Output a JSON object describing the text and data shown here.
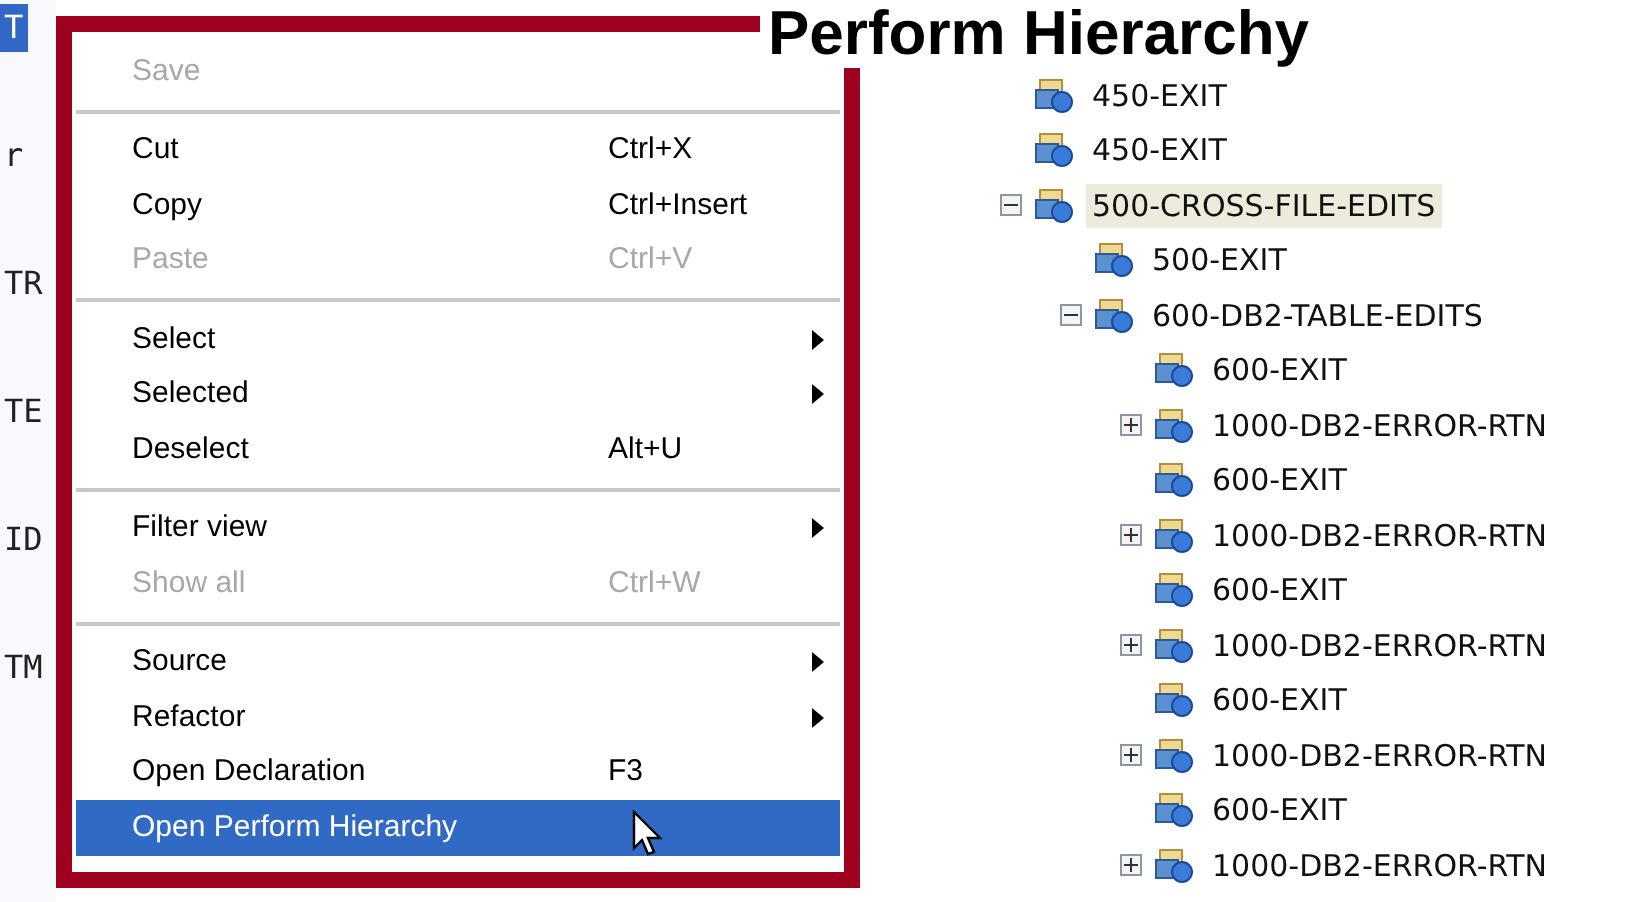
{
  "title": "Perform Hierarchy",
  "editor_fragments": [
    {
      "text": "T",
      "selected": true
    },
    {
      "text": "r",
      "selected": false
    },
    {
      "text": "TR",
      "selected": false
    },
    {
      "text": "TE",
      "selected": false
    },
    {
      "text": "ID",
      "selected": false
    },
    {
      "text": "TM",
      "selected": false
    }
  ],
  "menu": {
    "groups": [
      [
        {
          "label": "Save",
          "disabled": true,
          "submenu": false,
          "selected": false
        }
      ],
      [
        {
          "label": "Cut",
          "shortcut": "Ctrl+X",
          "disabled": false,
          "submenu": false,
          "selected": false
        },
        {
          "label": "Copy",
          "shortcut": "Ctrl+Insert",
          "disabled": false,
          "submenu": false,
          "selected": false
        },
        {
          "label": "Paste",
          "shortcut": "Ctrl+V",
          "disabled": true,
          "submenu": false,
          "selected": false
        }
      ],
      [
        {
          "label": "Select",
          "disabled": false,
          "submenu": true,
          "selected": false
        },
        {
          "label": "Selected",
          "disabled": false,
          "submenu": true,
          "selected": false
        },
        {
          "label": "Deselect",
          "shortcut": "Alt+U",
          "disabled": false,
          "submenu": false,
          "selected": false
        }
      ],
      [
        {
          "label": "Filter view",
          "disabled": false,
          "submenu": true,
          "selected": false
        },
        {
          "label": "Show all",
          "shortcut": "Ctrl+W",
          "disabled": true,
          "submenu": false,
          "selected": false
        }
      ],
      [
        {
          "label": "Source",
          "disabled": false,
          "submenu": true,
          "selected": false
        },
        {
          "label": "Refactor",
          "disabled": false,
          "submenu": true,
          "selected": false
        },
        {
          "label": "Open Declaration",
          "shortcut": "F3",
          "disabled": false,
          "submenu": false,
          "selected": false
        },
        {
          "label": "Open Perform Hierarchy",
          "disabled": false,
          "submenu": false,
          "selected": true
        }
      ]
    ]
  },
  "tree": [
    {
      "label": "450-EXIT",
      "kind": "leaf",
      "selected": false
    },
    {
      "label": "450-EXIT",
      "kind": "leaf",
      "selected": false
    },
    {
      "label": "500-CROSS-FILE-EDITS",
      "kind": "branch",
      "expanded": true,
      "selected": true,
      "children": [
        {
          "label": "500-EXIT",
          "kind": "leaf",
          "selected": false
        },
        {
          "label": "600-DB2-TABLE-EDITS",
          "kind": "branch",
          "expanded": true,
          "selected": false,
          "children": [
            {
              "label": "600-EXIT",
              "kind": "leaf",
              "selected": false
            },
            {
              "label": "1000-DB2-ERROR-RTN",
              "kind": "branch",
              "expanded": false,
              "selected": false
            },
            {
              "label": "600-EXIT",
              "kind": "leaf",
              "selected": false
            },
            {
              "label": "1000-DB2-ERROR-RTN",
              "kind": "branch",
              "expanded": false,
              "selected": false
            },
            {
              "label": "600-EXIT",
              "kind": "leaf",
              "selected": false
            },
            {
              "label": "1000-DB2-ERROR-RTN",
              "kind": "branch",
              "expanded": false,
              "selected": false
            },
            {
              "label": "600-EXIT",
              "kind": "leaf",
              "selected": false
            },
            {
              "label": "1000-DB2-ERROR-RTN",
              "kind": "branch",
              "expanded": false,
              "selected": false
            },
            {
              "label": "600-EXIT",
              "kind": "leaf",
              "selected": false
            },
            {
              "label": "1000-DB2-ERROR-RTN",
              "kind": "branch",
              "expanded": false,
              "selected": false
            }
          ]
        }
      ]
    }
  ]
}
